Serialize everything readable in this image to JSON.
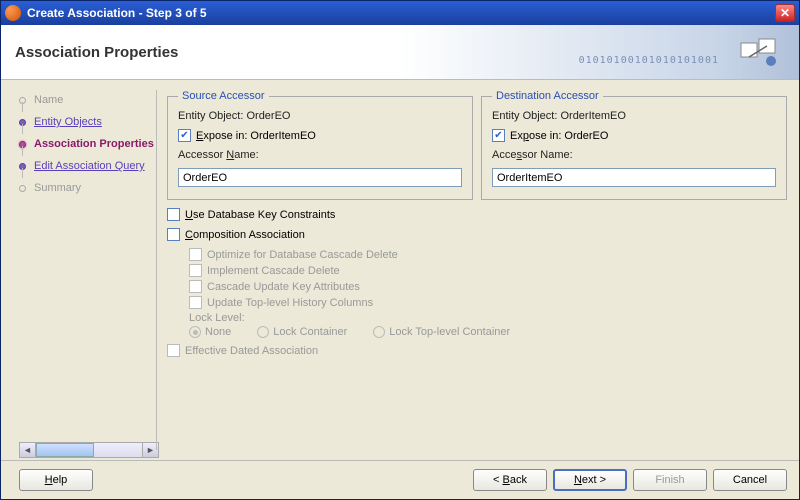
{
  "window": {
    "title": "Create Association - Step 3 of 5"
  },
  "header": {
    "title": "Association Properties"
  },
  "nav": {
    "items": [
      {
        "label": "Name",
        "state": "visited"
      },
      {
        "label": "Entity Objects",
        "state": "visited"
      },
      {
        "label": "Association Properties",
        "state": "current"
      },
      {
        "label": "Edit Association Query",
        "state": "visited"
      },
      {
        "label": "Summary",
        "state": "pending"
      }
    ]
  },
  "source": {
    "legend": "Source Accessor",
    "entity_label": "Entity Object: OrderEO",
    "expose_label": "Expose in: OrderItemEO",
    "expose_checked": true,
    "accessor_name_label": "Accessor Name:",
    "accessor_name_value": "OrderEO"
  },
  "destination": {
    "legend": "Destination Accessor",
    "entity_label": "Entity Object: OrderItemEO",
    "expose_label": "Expose in: OrderEO",
    "expose_checked": true,
    "accessor_name_label": "Accessor Name:",
    "accessor_name_value": "OrderItemEO"
  },
  "options": {
    "use_db_key": "Use Database Key Constraints",
    "composition": "Composition Association",
    "optimize_cascade": "Optimize for Database Cascade Delete",
    "implement_cascade": "Implement Cascade Delete",
    "cascade_update": "Cascade Update Key Attributes",
    "update_history": "Update Top-level History Columns",
    "lock_level_label": "Lock Level:",
    "lock_none": "None",
    "lock_container": "Lock Container",
    "lock_top": "Lock Top-level Container",
    "effective_dated": "Effective Dated Association"
  },
  "footer": {
    "help": "Help",
    "back": "< Back",
    "next": "Next >",
    "finish": "Finish",
    "cancel": "Cancel"
  }
}
